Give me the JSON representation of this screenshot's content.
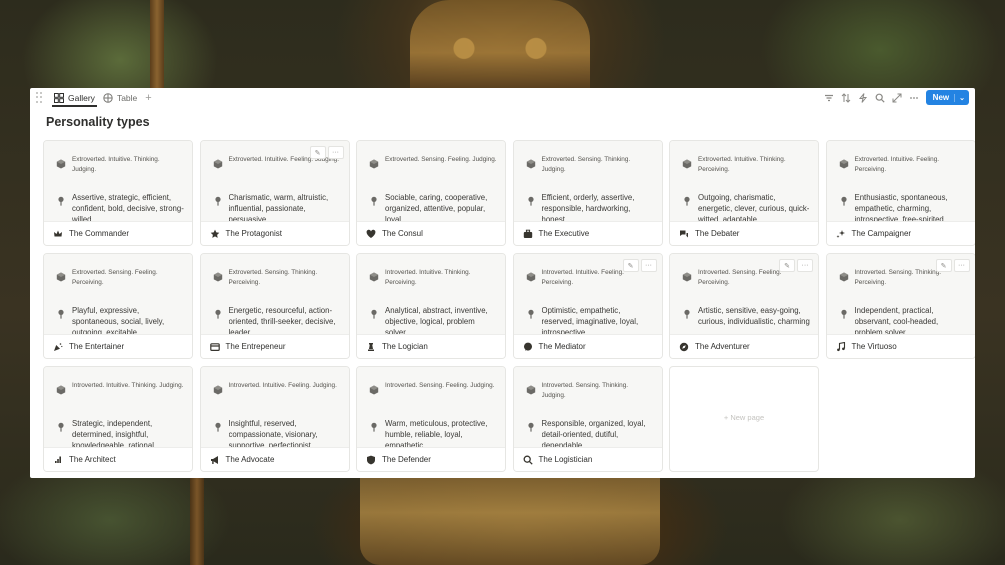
{
  "tabs": [
    {
      "label": "Gallery",
      "icon": "gallery-icon",
      "active": true
    },
    {
      "label": "Table",
      "icon": "table-icon",
      "active": false
    }
  ],
  "toolbar": {
    "add_view": "+",
    "new_label": "New",
    "new_dropdown": "⌄",
    "icons": [
      "filter-icon",
      "sort-icon",
      "lightning-icon",
      "search-icon",
      "expand-icon",
      "more-icon"
    ]
  },
  "page_title": "Personality types",
  "cards": [
    {
      "name": "The Commander",
      "icon": "crown-icon",
      "traits": "Extroverted. Intuitive. Thinking. Judging.",
      "description": "Assertive, strategic, efficient, confident, bold, decisive, strong-willed",
      "hover": false
    },
    {
      "name": "The Protagonist",
      "icon": "star-icon",
      "traits": "Extroverted. Intuitive. Feeling. Judging.",
      "description": "Charismatic, warm, altruistic, influential, passionate, persuasive",
      "hover": true
    },
    {
      "name": "The Consul",
      "icon": "heart-icon",
      "traits": "Extroverted. Sensing. Feeling. Judging.",
      "description": "Sociable, caring, cooperative, organized, attentive, popular, loyal",
      "hover": false
    },
    {
      "name": "The Executive",
      "icon": "briefcase-icon",
      "traits": "Extroverted. Sensing. Thinking. Judging.",
      "description": "Efficient, orderly, assertive, responsible, hardworking, honest",
      "hover": false
    },
    {
      "name": "The Debater",
      "icon": "chat-icon",
      "traits": "Extroverted. Intuitive. Thinking. Perceiving.",
      "description": "Outgoing, charismatic, energetic, clever, curious, quick-witted, adaptable",
      "hover": false
    },
    {
      "name": "The Campaigner",
      "icon": "sparkle-icon",
      "traits": "Extroverted. Intuitive. Feeling. Perceiving.",
      "description": "Enthusiastic, spontaneous, empathetic, charming, introspective, free-spirited",
      "hover": false
    },
    {
      "name": "The Entertainer",
      "icon": "party-icon",
      "traits": "Extroverted. Sensing. Feeling. Perceiving.",
      "description": "Playful, expressive, spontaneous, social, lively, outgoing, excitable",
      "hover": false
    },
    {
      "name": "The Entrepeneur",
      "icon": "wallet-icon",
      "traits": "Extroverted. Sensing. Thinking. Perceiving.",
      "description": "Energetic, resourceful, action-oriented, thrill-seeker, decisive, leader",
      "hover": false
    },
    {
      "name": "The Logician",
      "icon": "chess-icon",
      "traits": "Introverted. Intuitive. Thinking. Perceiving.",
      "description": "Analytical, abstract, inventive, objective, logical, problem solver",
      "hover": false
    },
    {
      "name": "The Mediator",
      "icon": "speech-icon",
      "traits": "Introverted. Intuitive. Feeling. Perceiving.",
      "description": "Optimistic, empathetic, reserved, imaginative, loyal, introspective",
      "hover": true
    },
    {
      "name": "The Adventurer",
      "icon": "compass-icon",
      "traits": "Introverted. Sensing. Feeling. Perceiving.",
      "description": "Artistic, sensitive, easy-going, curious, individualistic, charming",
      "hover": true
    },
    {
      "name": "The Virtuoso",
      "icon": "music-icon",
      "traits": "Introverted. Sensing. Thinking. Perceiving.",
      "description": "Independent, practical, observant, cool-headed, problem solver",
      "hover": true
    },
    {
      "name": "The Architect",
      "icon": "chart-icon",
      "traits": "Introverted. Intuitive. Thinking. Judging.",
      "description": "Strategic, independent, determined, insightful, knowledgeable, rational",
      "hover": false
    },
    {
      "name": "The Advocate",
      "icon": "megaphone-icon",
      "traits": "Introverted. Intuitive. Feeling. Judging.",
      "description": "Insightful, reserved, compassionate, visionary, supportive, perfectionist",
      "hover": false
    },
    {
      "name": "The Defender",
      "icon": "shield-icon",
      "traits": "Introverted. Sensing. Feeling. Judging.",
      "description": "Warm, meticulous, protective, humble, reliable, loyal, empathetic",
      "hover": false
    },
    {
      "name": "The Logistician",
      "icon": "magnifier-icon",
      "traits": "Introverted. Sensing. Thinking. Judging.",
      "description": "Responsible, organized, loyal, detail-oriented, dutiful, dependable",
      "hover": false
    }
  ],
  "new_page_label": "+ New page",
  "card_tools": {
    "edit": "✎",
    "more": "···"
  },
  "colors": {
    "accent": "#2383e2",
    "text": "#2f2f2d",
    "preview_bg": "#f7f7f5"
  }
}
